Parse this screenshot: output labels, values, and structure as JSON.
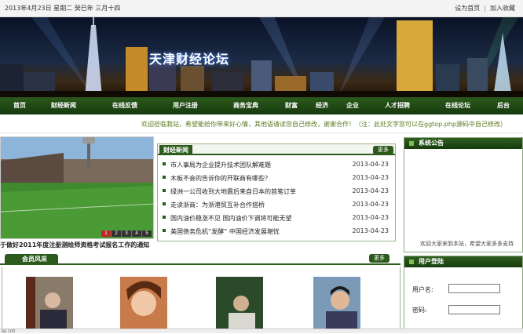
{
  "topbar": {
    "date_text": "2013年4月23日 星期二 癸巳年 三月十四",
    "set_home": "设为首页",
    "separator": "|",
    "add_favorite": "加入收藏"
  },
  "banner": {
    "site_title": "天津财经论坛"
  },
  "nav": {
    "items": [
      "首页",
      "财经新闻",
      "在线反馈",
      "用户注册",
      "商务宝典",
      "财富",
      "经济",
      "企业",
      "人才招聘",
      "在线论坛",
      "后台"
    ]
  },
  "notice": {
    "text": "欢迎莅临我站，希望能给你带来好心情，其他语请读您自己修改，谢谢合作！（注：此处文字您可以在ggtop.php源码中自己修改）"
  },
  "slideshow": {
    "caption": "于做好2011年度注册测绘师资格考试报名工作的通知",
    "pager": [
      "1",
      "2",
      "3",
      "4",
      "5"
    ],
    "active_index": 0
  },
  "news": {
    "tab_label": "财经新闻",
    "more_label": "更多",
    "items": [
      {
        "title": "市人事局为企业提升技术团队解难题",
        "date": "2013-04-23"
      },
      {
        "title": "木板不会的告诉你的开联商有哪些？",
        "date": "2013-04-23"
      },
      {
        "title": "绿洲一公司收到大地震后来自日本的首笔订单",
        "date": "2013-04-23"
      },
      {
        "title": "走读浙商：为浙港贸互补合作搭桥",
        "date": "2013-04-23"
      },
      {
        "title": "国内油价稳涨不见  国内油价下调将可能无望",
        "date": "2013-04-23"
      },
      {
        "title": "美国债务危机“发酵”  中国经济发展堪忧",
        "date": "2013-04-23"
      }
    ]
  },
  "announcement": {
    "title": "系统公告",
    "scroll_text": "欢迎大家来到本站，希望大家多多支持"
  },
  "members": {
    "tab_label": "会员风采",
    "more_label": "更多"
  },
  "login": {
    "title": "用户登陆",
    "username_label": "用户名:",
    "password_label": "密码:"
  },
  "statusbar": {
    "text": "Ajl 100"
  },
  "colors": {
    "nav_green": "#2c5a1c",
    "notice_green": "#5a7a20",
    "active_pager": "#c0262b"
  }
}
